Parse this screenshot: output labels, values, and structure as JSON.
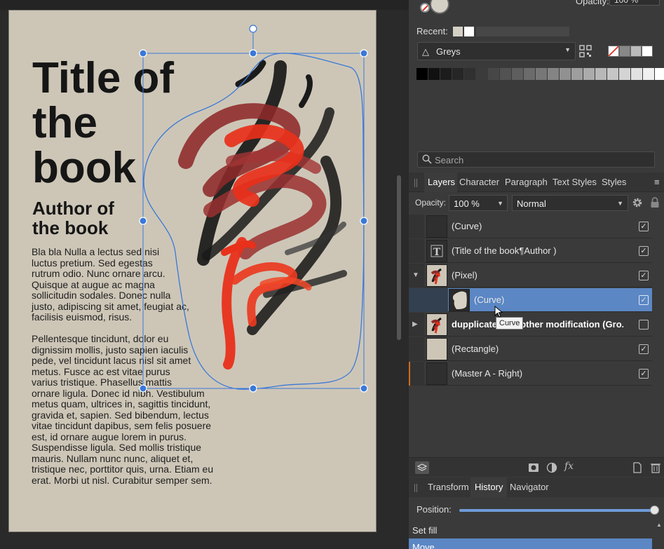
{
  "document": {
    "title_lines": [
      "Title of",
      "the",
      "book"
    ],
    "author_lines": [
      "Author of",
      "the book"
    ],
    "body_p1": [
      "Bla bla Nulla a lectus sed nisi",
      "luctus pretium. Sed egestas",
      "rutrum odio. Nunc ornare arcu.",
      "Quisque at augue ac magna",
      "sollicitudin sodales. Donec nulla",
      "justo, adipiscing sit amet, feugiat ac,",
      "facilisis euismod, risus."
    ],
    "body_p2": [
      "Pellentesque tincidunt, dolor eu",
      "dignissim mollis, justo sapien iaculis",
      "pede, vel tincidunt lacus nisl sit amet",
      "metus. Fusce ac est vitae purus",
      "varius tristique. Phasellus mattis",
      "ornare ligula. Donec id nibh. Vestibulum",
      "metus quam, ultrices in, sagittis tincidunt,",
      "gravida et, sapien. Sed bibendum, lectus",
      "vitae tincidunt dapibus, sem felis posuere",
      "est, id ornare augue lorem in purus.",
      "Suspendisse ligula. Sed mollis tristique",
      "mauris. Nullam nunc nunc, aliquet et,",
      "tristique nec, porttitor quis, urna. Etiam eu",
      "erat. Morbi ut nisl. Curabitur semper sem."
    ]
  },
  "colors": {
    "page": "#cdc6b7",
    "selection": "#3a78d8",
    "accent": "#5b87c4",
    "brush_red": "#e8301a",
    "brush_maroon": "#8e2a2a",
    "brush_black": "#141414"
  },
  "swatch_panel": {
    "opacity_label": "Opacity:",
    "opacity_value": "100 %",
    "recent_label": "Recent:",
    "recent_colors": [
      "#d5d0c6",
      "#ffffff"
    ],
    "palette_name": "Greys",
    "quick_swatches": [
      "#ffffff",
      "#888888",
      "#bbbbbb",
      "#ffffff"
    ],
    "greys": [
      "#000000",
      "#111111",
      "#1c1c1c",
      "#262626",
      "#303030",
      "#3b3b3b",
      "#474747",
      "#525252",
      "#5e5e5e",
      "#6b6b6b",
      "#777777",
      "#848484",
      "#919191",
      "#9e9e9e",
      "#ababab",
      "#b8b8b8",
      "#c6c6c6",
      "#d4d4d4",
      "#e2e2e2",
      "#f0f0f0",
      "#ffffff"
    ]
  },
  "search": {
    "placeholder": "Search"
  },
  "layers_panel": {
    "tabs": [
      "Layers",
      "Character",
      "Paragraph",
      "Text Styles",
      "Styles"
    ],
    "opacity_label": "Opacity:",
    "opacity_value": "100 %",
    "blend_mode": "Normal",
    "layers": [
      {
        "name": "(Curve)",
        "checked": true
      },
      {
        "name": "(Title of the book¶Author )",
        "checked": true
      },
      {
        "name": "(Pixel)",
        "checked": true
      },
      {
        "name": "(Curve)",
        "checked": true
      },
      {
        "name": "dupplicate with other modification (Gro...",
        "checked": false
      },
      {
        "name": "(Rectangle)",
        "checked": true
      },
      {
        "name": "(Master A - Right)",
        "checked": true
      }
    ],
    "tooltip": "Curve"
  },
  "history_panel": {
    "tabs": [
      "Transform",
      "History",
      "Navigator"
    ],
    "position_label": "Position:",
    "position_fraction": 1.0,
    "items": [
      "Set fill",
      "Move"
    ]
  }
}
